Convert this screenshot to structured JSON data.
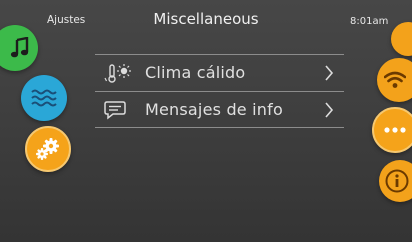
{
  "header": {
    "back_label": "Ajustes",
    "title": "Miscellaneous",
    "time": "8:01am"
  },
  "left_nav": [
    {
      "icon": "music-note-icon",
      "color": "#3cba4a"
    },
    {
      "icon": "water-waves-icon",
      "color": "#2aa7d7"
    },
    {
      "icon": "gears-icon",
      "color": "#f5a31a"
    }
  ],
  "right_nav": [
    {
      "icon": "wifi-icon",
      "color": "#f3a21b"
    },
    {
      "icon": "more-dots-icon",
      "color": "#f5a31a"
    },
    {
      "icon": "info-icon",
      "color": "#f3a21b"
    }
  ],
  "menu": {
    "items": [
      {
        "label": "Clima cálido",
        "icon": "thermometer-sun-icon"
      },
      {
        "label": "Mensajes de info",
        "icon": "message-icon"
      }
    ]
  }
}
